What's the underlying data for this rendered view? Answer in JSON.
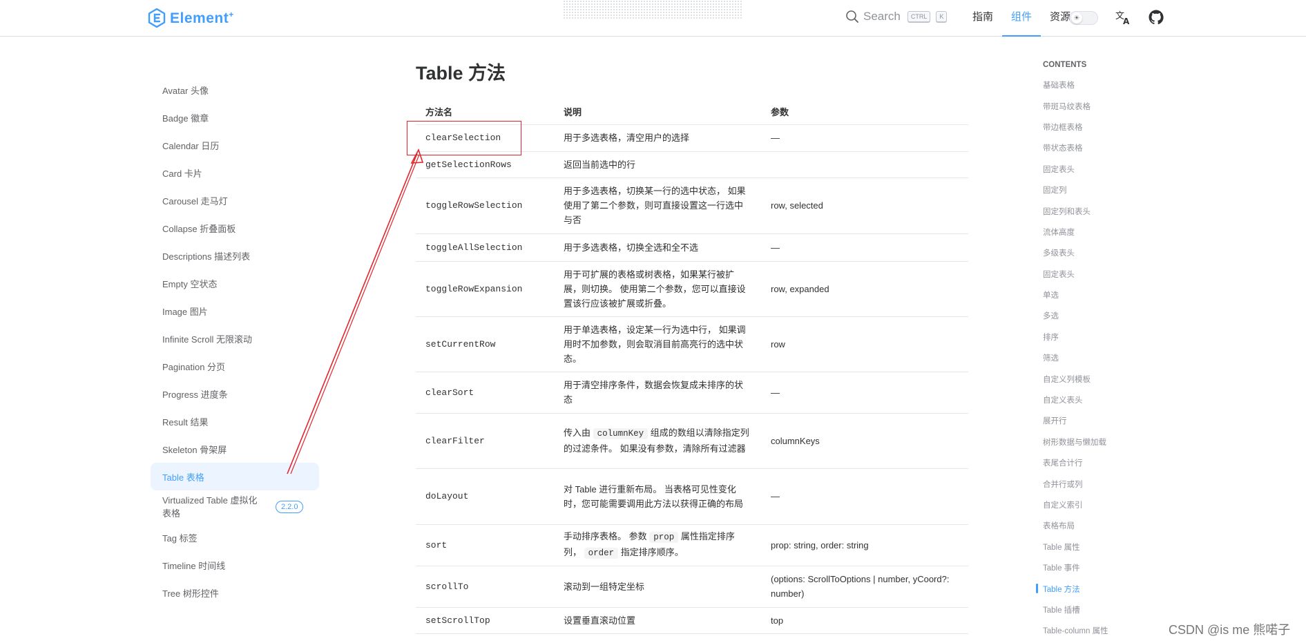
{
  "header": {
    "logo_text": "Element",
    "logo_plus": "+",
    "search_label": "Search",
    "kbd_ctrl": "CTRL",
    "kbd_k": "K",
    "nav": [
      "指南",
      "组件",
      "资源"
    ],
    "nav_active_index": 1
  },
  "sidebar": {
    "items": [
      "Avatar 头像",
      "Badge 徽章",
      "Calendar 日历",
      "Card 卡片",
      "Carousel 走马灯",
      "Collapse 折叠面板",
      "Descriptions 描述列表",
      "Empty 空状态",
      "Image 图片",
      "Infinite Scroll 无限滚动",
      "Pagination 分页",
      "Progress 进度条",
      "Result 结果",
      "Skeleton 骨架屏",
      "Table 表格",
      "Virtualized Table 虚拟化表格",
      "Tag 标签",
      "Timeline 时间线",
      "Tree 树形控件"
    ],
    "virtualized_badge": "2.2.0",
    "active_index": 14
  },
  "main": {
    "title": "Table 方法",
    "columns": [
      "方法名",
      "说明",
      "参数"
    ],
    "rows": [
      {
        "method": "clearSelection",
        "desc": "用于多选表格，清空用户的选择",
        "params": "—"
      },
      {
        "method": "getSelectionRows",
        "desc": "返回当前选中的行",
        "params": ""
      },
      {
        "method": "toggleRowSelection",
        "desc": "用于多选表格，切换某一行的选中状态， 如果使用了第二个参数，则可直接设置这一行选中与否",
        "params": "row, selected"
      },
      {
        "method": "toggleAllSelection",
        "desc": "用于多选表格，切换全选和全不选",
        "params": "—"
      },
      {
        "method": "toggleRowExpansion",
        "desc": "用于可扩展的表格或树表格，如果某行被扩展，则切换。 使用第二个参数，您可以直接设置该行应该被扩展或折叠。",
        "params": "row, expanded"
      },
      {
        "method": "setCurrentRow",
        "desc": "用于单选表格，设定某一行为选中行， 如果调用时不加参数，则会取消目前高亮行的选中状态。",
        "params": "row"
      },
      {
        "method": "clearSort",
        "desc": "用于清空排序条件，数据会恢复成未排序的状态",
        "params": "—"
      },
      {
        "method": "clearFilter",
        "desc_pre": "传入由 ",
        "desc_code": "columnKey",
        "desc_post": " 组成的数组以清除指定列的过滤条件。 如果没有参数，清除所有过滤器",
        "params": "columnKeys"
      },
      {
        "method": "doLayout",
        "desc": "对 Table 进行重新布局。 当表格可见性变化时，您可能需要调用此方法以获得正确的布局",
        "params": "—"
      },
      {
        "method": "sort",
        "desc_pre": "手动排序表格。 参数 ",
        "desc_code": "prop",
        "desc_mid": " 属性指定排序列， ",
        "desc_code2": "order",
        "desc_post": " 指定排序顺序。",
        "params": "prop: string, order: string"
      },
      {
        "method": "scrollTo",
        "desc": "滚动到一组特定坐标",
        "params": "(options: ScrollToOptions | number, yCoord?: number)"
      },
      {
        "method": "setScrollTop",
        "desc": "设置垂直滚动位置",
        "params": "top"
      }
    ]
  },
  "toc": {
    "title": "CONTENTS",
    "items": [
      "基础表格",
      "带斑马纹表格",
      "带边框表格",
      "带状态表格",
      "固定表头",
      "固定列",
      "固定列和表头",
      "流体高度",
      "多级表头",
      "固定表头",
      "单选",
      "多选",
      "排序",
      "筛选",
      "自定义列模板",
      "自定义表头",
      "展开行",
      "树形数据与懒加载",
      "表尾合计行",
      "合并行或列",
      "自定义索引",
      "表格布局",
      "Table 属性",
      "Table 事件",
      "Table 方法",
      "Table 插槽",
      "Table-column 属性"
    ],
    "active_index": 24
  },
  "watermark": "CSDN @is me 熊喏子",
  "colors": {
    "accent": "#409eff",
    "annotation": "#e3242b"
  }
}
